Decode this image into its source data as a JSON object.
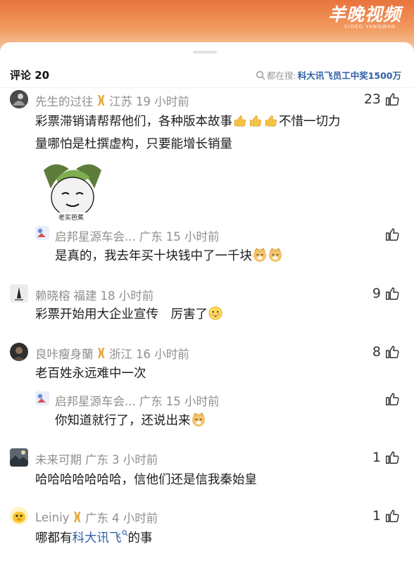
{
  "brand": {
    "name": "羊晚视频",
    "subtitle": "VIDEO YANGWAN"
  },
  "header": {
    "count": "评论 20",
    "search_prefix": "都在搜:",
    "search_keyword": "科大讯飞员工中奖1500万"
  },
  "comments": [
    {
      "name": "先生的过往",
      "location": "江苏",
      "time": "19 小时前",
      "likes": "23",
      "text": "彩票滞销请帮帮他们，各种版本故事",
      "text2": "不惜一切力",
      "text3": "量哪怕是杜撰虚构，只要能增长销量",
      "sticker_caption": "老实芭蕉"
    },
    {
      "name": "启邦星源车会...",
      "location": "广东",
      "time": "15 小时前",
      "likes": "",
      "text": "是真的，我去年买十块钱中了一千块"
    },
    {
      "name": "赖晓榕",
      "location": "福建",
      "time": "18 小时前",
      "likes": "9",
      "text": "彩票开始用大企业宣传　厉害了"
    },
    {
      "name": "良咔瘦身蘭",
      "location": "浙江",
      "time": "16 小时前",
      "likes": "8",
      "text": "老百姓永远难中一次"
    },
    {
      "name": "启邦星源车会...",
      "location": "广东",
      "time": "15 小时前",
      "likes": "",
      "text": "你知道就行了，还说出来"
    },
    {
      "name": "未来可期",
      "location": "广东",
      "time": "3 小时前",
      "likes": "1",
      "text": "哈哈哈哈哈哈哈，信他们还是信我秦始皇"
    },
    {
      "name": "Leiniy",
      "location": "广东",
      "time": "4 小时前",
      "likes": "1",
      "text_prefix": "哪都有",
      "text_link": "科大讯飞",
      "text_suffix": "的事"
    }
  ],
  "colors": {
    "accent_orange": "#e8743d",
    "link_blue": "#2f5fa6",
    "badge_gold": "#e4a93c"
  }
}
